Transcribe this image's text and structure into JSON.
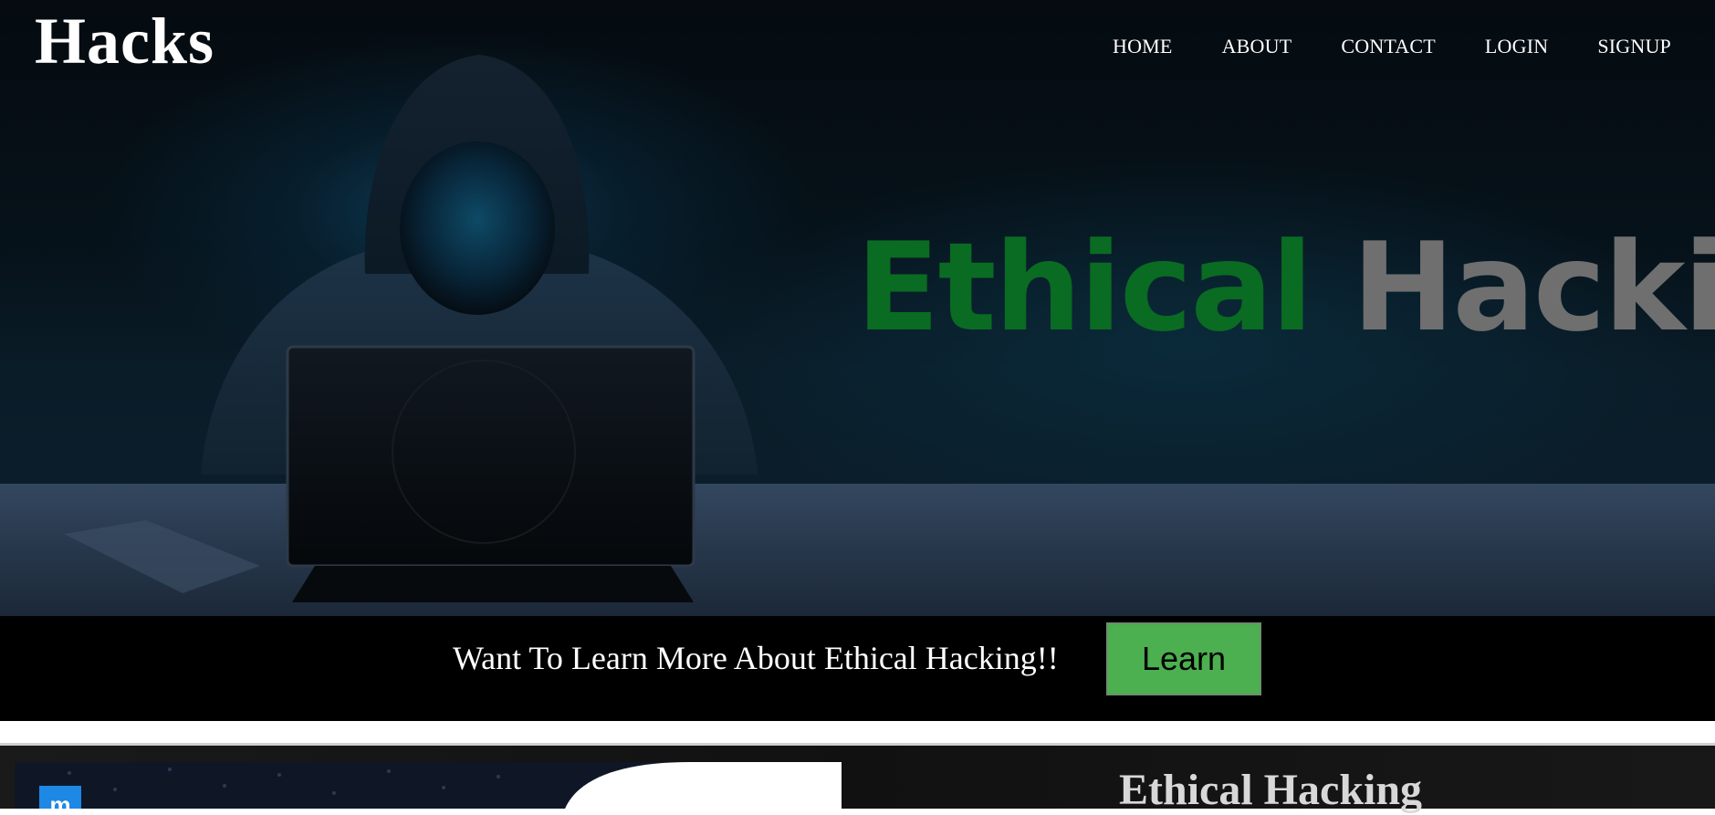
{
  "brand": {
    "name": "Hacks"
  },
  "nav": {
    "items": [
      {
        "label": "HOME"
      },
      {
        "label": "ABOUT"
      },
      {
        "label": "CONTACT"
      },
      {
        "label": "LOGIN"
      },
      {
        "label": "SIGNUP"
      }
    ]
  },
  "hero": {
    "title_word_1": "Ethical",
    "title_word_2": "Hacking",
    "title_colors": {
      "word_1": "#0a6b22",
      "word_2": "#6f6f6f"
    }
  },
  "cta": {
    "text": "Want To Learn More About Ethical Hacking!!",
    "button_label": "Learn",
    "button_color": "#4caf50"
  },
  "section": {
    "title": "Ethical Hacking"
  }
}
